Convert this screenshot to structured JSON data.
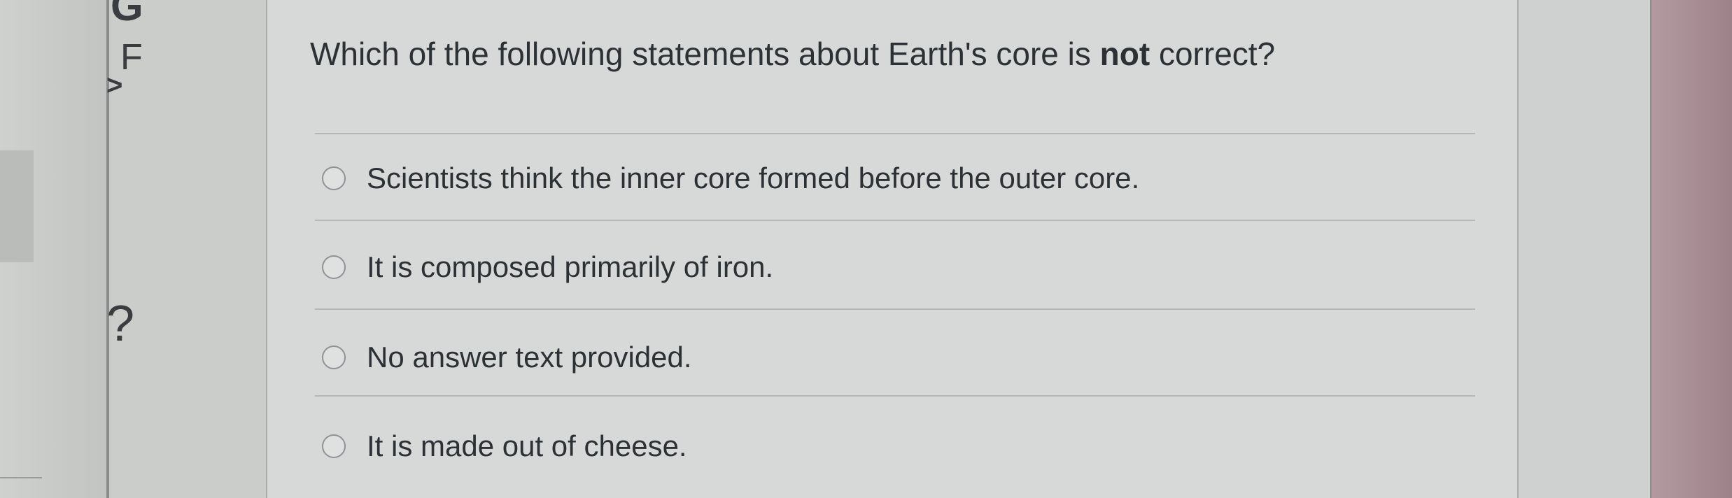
{
  "sidebar": {
    "glyphs": [
      "G",
      "F",
      ">",
      "?"
    ]
  },
  "question": {
    "text_before": "Which of the following statements about Earth's core is ",
    "emphasis": "not",
    "text_after": " correct?"
  },
  "answers": [
    {
      "label": "Scientists think the inner core formed before the outer core.",
      "selected": false
    },
    {
      "label": "It is composed primarily of iron.",
      "selected": false
    },
    {
      "label": "No answer text provided.",
      "selected": false
    },
    {
      "label": "It is made out of cheese.",
      "selected": false
    }
  ],
  "colors": {
    "text": "#2c3135",
    "card": "#d7d9d8",
    "divider": "#b4b7b7",
    "radio_border": "#8d9294"
  }
}
